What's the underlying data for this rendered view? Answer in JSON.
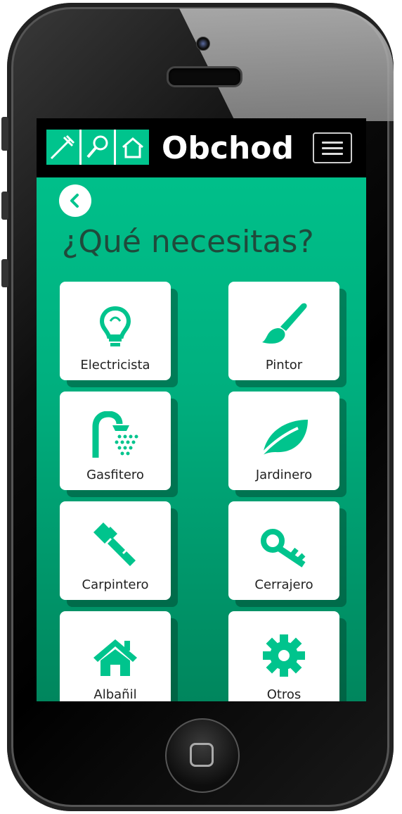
{
  "app": {
    "brand": "Obchod"
  },
  "page": {
    "title": "¿Qué necesitas?"
  },
  "colors": {
    "accent": "#00c48d",
    "title": "#1f4a3b",
    "navbar": "#000000"
  },
  "services": [
    {
      "label": "Electricista",
      "icon": "lightbulb-icon"
    },
    {
      "label": "Pintor",
      "icon": "paintbrush-icon"
    },
    {
      "label": "Gasfitero",
      "icon": "shower-icon"
    },
    {
      "label": "Jardinero",
      "icon": "leaf-icon"
    },
    {
      "label": "Carpintero",
      "icon": "hammer-icon"
    },
    {
      "label": "Cerrajero",
      "icon": "key-icon"
    },
    {
      "label": "Albañil",
      "icon": "house-icon"
    },
    {
      "label": "Otros",
      "icon": "gear-icon"
    }
  ]
}
